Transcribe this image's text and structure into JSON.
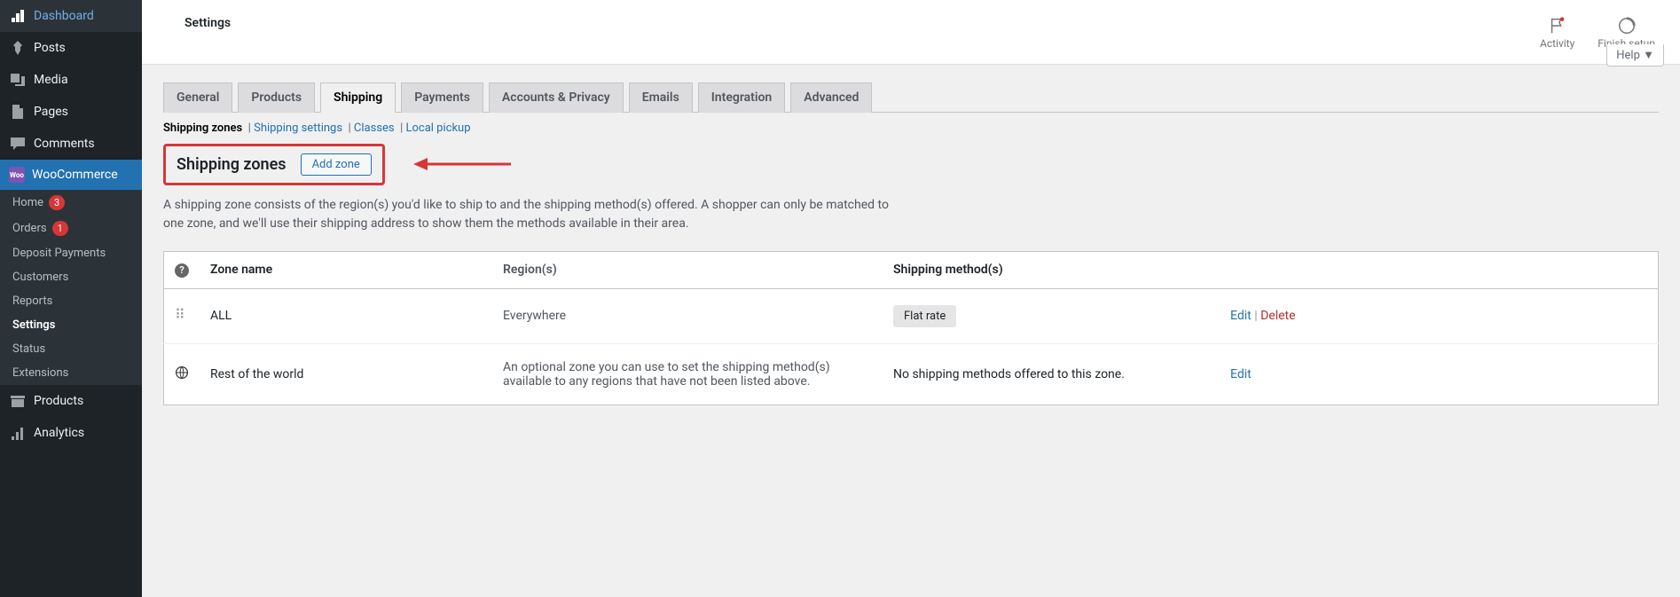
{
  "sidebar": {
    "items": [
      {
        "label": "Dashboard"
      },
      {
        "label": "Posts"
      },
      {
        "label": "Media"
      },
      {
        "label": "Pages"
      },
      {
        "label": "Comments"
      },
      {
        "label": "WooCommerce"
      },
      {
        "label": "Products"
      },
      {
        "label": "Analytics"
      }
    ],
    "woosub": [
      {
        "label": "Home",
        "badge": "3"
      },
      {
        "label": "Orders",
        "badge": "1"
      },
      {
        "label": "Deposit Payments"
      },
      {
        "label": "Customers"
      },
      {
        "label": "Reports"
      },
      {
        "label": "Settings",
        "current": true
      },
      {
        "label": "Status"
      },
      {
        "label": "Extensions"
      }
    ]
  },
  "topbar": {
    "title": "Settings",
    "activity": "Activity",
    "finish": "Finish setup",
    "help": "Help ▼"
  },
  "tabs": [
    "General",
    "Products",
    "Shipping",
    "Payments",
    "Accounts & Privacy",
    "Emails",
    "Integration",
    "Advanced"
  ],
  "activeTab": "Shipping",
  "subtabs": {
    "current": "Shipping zones",
    "links": [
      "Shipping settings",
      "Classes",
      "Local pickup"
    ]
  },
  "heading": {
    "title": "Shipping zones",
    "action": "Add zone"
  },
  "description": "A shipping zone consists of the region(s) you'd like to ship to and the shipping method(s) offered. A shopper can only be matched to one zone, and we'll use their shipping address to show them the methods available in their area.",
  "table": {
    "headers": {
      "name": "Zone name",
      "region": "Region(s)",
      "methods": "Shipping method(s)"
    },
    "rows": [
      {
        "name": "ALL",
        "region": "Everywhere",
        "methods": [
          "Flat rate"
        ],
        "actions": [
          "Edit",
          "Delete"
        ]
      },
      {
        "name": "Rest of the world",
        "region": "An optional zone you can use to set the shipping method(s) available to any regions that have not been listed above.",
        "methods_text": "No shipping methods offered to this zone.",
        "actions": [
          "Edit"
        ],
        "globe": true
      }
    ],
    "labels": {
      "edit": "Edit",
      "delete": "Delete"
    }
  }
}
